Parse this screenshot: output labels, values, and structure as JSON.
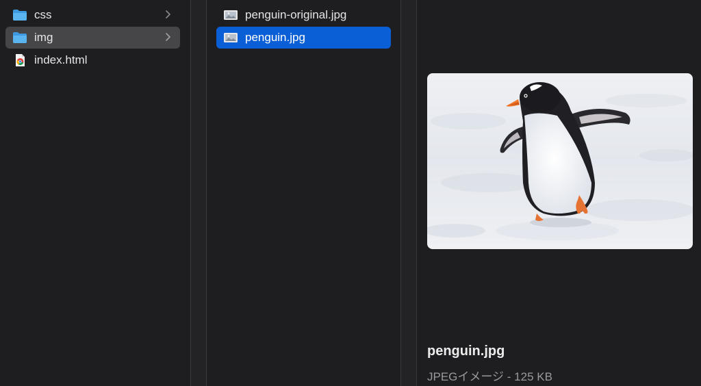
{
  "column1": {
    "items": [
      {
        "label": "css",
        "icon": "folder-icon",
        "has_children": true
      },
      {
        "label": "img",
        "icon": "folder-icon",
        "has_children": true
      },
      {
        "label": "index.html",
        "icon": "chrome-html-icon",
        "has_children": false
      }
    ]
  },
  "column2": {
    "items": [
      {
        "label": "penguin-original.jpg",
        "icon": "image-file-icon"
      },
      {
        "label": "penguin.jpg",
        "icon": "image-file-icon"
      }
    ]
  },
  "preview": {
    "image_alt": "penguin-photo",
    "filename": "penguin.jpg",
    "kind": "JPEGイメージ - 125 KB"
  },
  "colors": {
    "background": "#1e1e20",
    "selection": "#0a5fd6",
    "hover": "#464648",
    "folder": "#5ab4f0"
  }
}
